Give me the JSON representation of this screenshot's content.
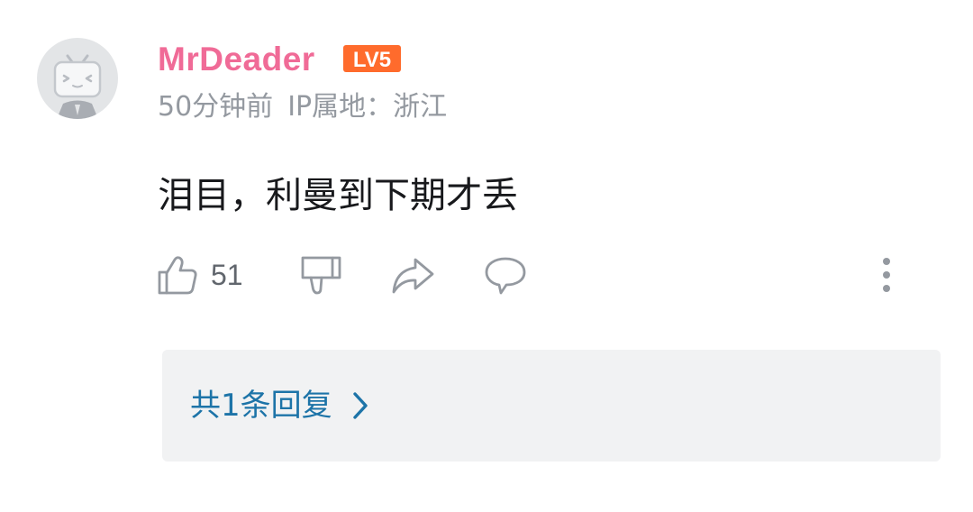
{
  "comment": {
    "username": "MrDeader",
    "level": "LV5",
    "time": "50分钟前",
    "ip_location": "IP属地：浙江",
    "text": "泪目，利曼到下期才丢",
    "like_count": "51",
    "replies_label": "共1条回复"
  },
  "colors": {
    "username": "#f06b97",
    "level_badge": "#ff6b2c",
    "meta": "#9499a0",
    "icon": "#9499a0",
    "reply_link": "#1d74a8",
    "reply_box_bg": "#f1f2f3"
  },
  "icons": {
    "avatar": "default-tv-avatar",
    "like": "thumbs-up-icon",
    "dislike": "thumbs-down-icon",
    "share": "share-arrow-icon",
    "reply": "speech-bubble-icon",
    "more": "vertical-ellipsis-icon",
    "replies": "chevron-right-icon"
  }
}
